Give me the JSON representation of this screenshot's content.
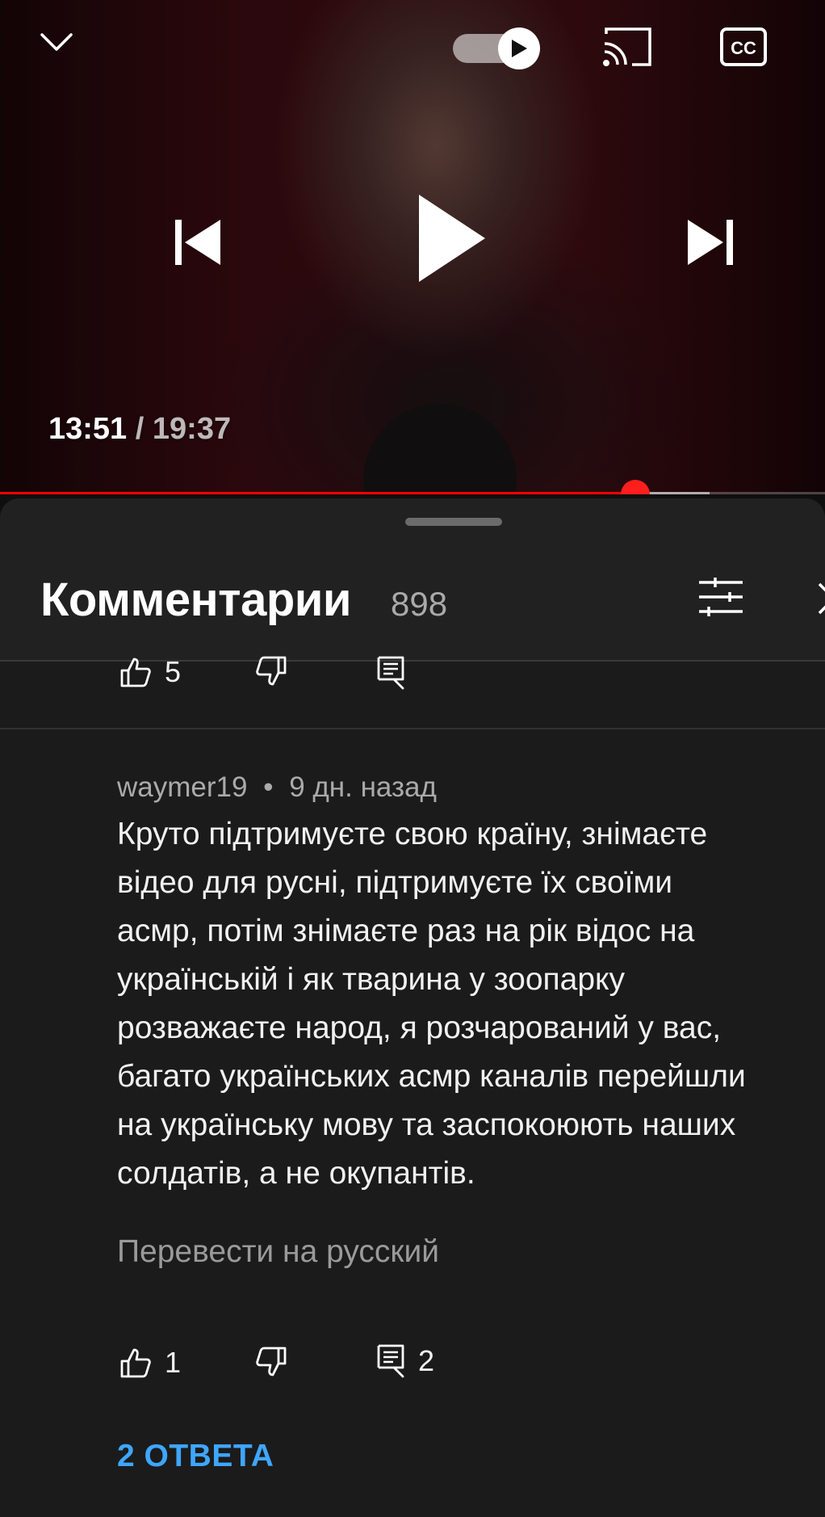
{
  "player": {
    "current_time": "13:51",
    "separator": "/",
    "duration": "19:37",
    "progress_fraction": 0.77,
    "buffered_fraction": 0.86,
    "autoplay_on": true,
    "icons": {
      "collapse": "chevron-down-icon",
      "autoplay": "autoplay-toggle",
      "cast": "cast-icon",
      "captions": "cc-icon",
      "previous": "skip-previous-icon",
      "play": "play-icon",
      "next": "skip-next-icon"
    }
  },
  "comments_panel": {
    "title": "Комментарии",
    "count": "898",
    "icons": {
      "sort": "sliders-icon",
      "close": "close-icon"
    }
  },
  "previous_comment": {
    "like_count": "5"
  },
  "comment": {
    "author": "waymer19",
    "meta_separator": "•",
    "time_ago": "9 дн. назад",
    "text": "Круто підтримуєте свою країну, знімаєте\nвідео для русні, підтримуєте їх своїми\nасмр, потім знімаєте раз на рік відос на\nукраїнській і як тварина у зоопарку\nрозважаєте народ, я розчарований у вас,\nбагато українських асмр каналів перейшли\nна українську мову та заспокоюють наших\nсолдатів, а не окупантів.",
    "translate_label": "Перевести на русский",
    "like_count": "1",
    "reply_count": "2",
    "replies_label": "2 ОТВЕТА"
  },
  "colors": {
    "accent_red": "#ff0000",
    "link_blue": "#3ea6ff",
    "sheet_bg": "#1b1b1b",
    "header_bg": "#212121"
  }
}
